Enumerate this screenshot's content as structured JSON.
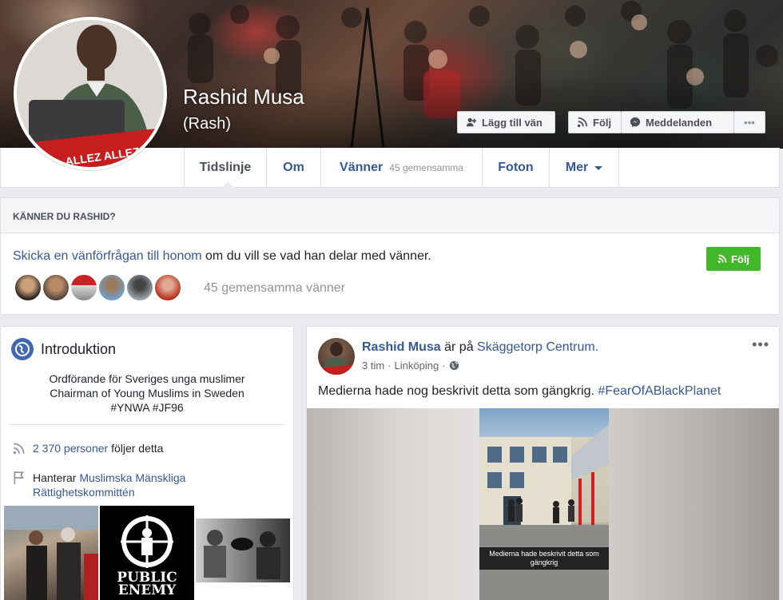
{
  "profile": {
    "name": "Rashid Musa",
    "alt_name": "(Rash)"
  },
  "cover_buttons": {
    "add_friend": "Lägg till vän",
    "follow": "Följ",
    "message": "Meddelanden",
    "more": "•••"
  },
  "nav": {
    "timeline": "Tidslinje",
    "about": "Om",
    "friends": "Vänner",
    "friends_sub": "45 gemensamma",
    "photos": "Foton",
    "more": "Mer"
  },
  "know": {
    "heading": "KÄNNER DU RASHID?",
    "link_text": "Skicka en vänförfrågan till honom",
    "rest_text": " om du vill se vad han delar med vänner.",
    "follow_label": "Följ",
    "mutual_text": "45 gemensamma vänner"
  },
  "intro": {
    "title": "Introduktion",
    "bio_lines": [
      "Ordförande för Sveriges unga muslimer",
      "Chairman of Young Muslims in Sweden",
      "#YNWA #JF96"
    ],
    "followers_link": "2 370 personer",
    "followers_rest": " följer detta",
    "manages_label": "Hanterar ",
    "manages_link": "Muslimska Mänskliga Rättighetskommittén"
  },
  "post": {
    "author": "Rashid Musa",
    "is_at": " är på ",
    "place": "Skäggetorp Centrum.",
    "time": "3 tim",
    "location": "Linköping",
    "text": "Medierna hade nog beskrivit detta som gängkrig. ",
    "hashtag": "#FearOfABlackPlanet",
    "video_caption": "Medierna hade beskrivit detta som gängkrig",
    "more": "•••"
  },
  "photo_texts": {
    "public_enemy": "PUBLIC ENEMY"
  },
  "colors": {
    "link": "#365899",
    "green": "#42b72a",
    "bg": "#e9ebee"
  }
}
